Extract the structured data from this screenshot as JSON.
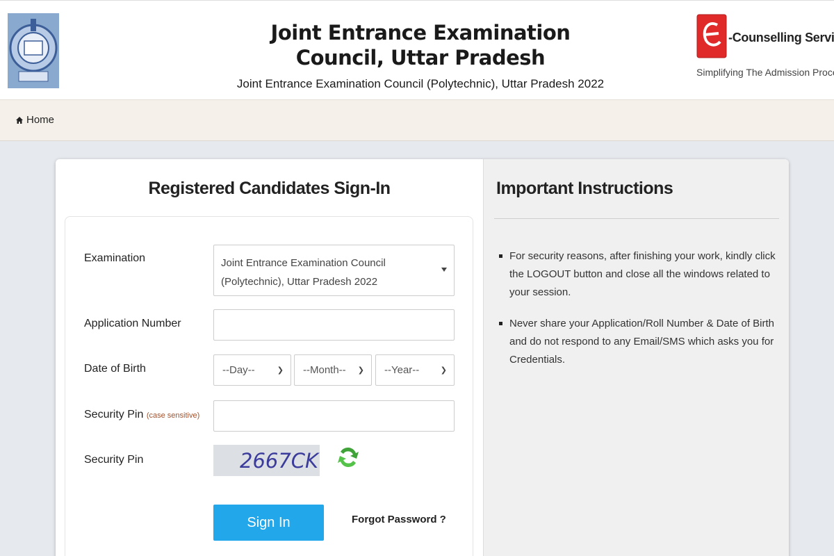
{
  "header": {
    "title": "Joint Entrance Examination Council, Uttar Pradesh",
    "subtitle": "Joint Entrance Examination Council (Polytechnic), Uttar Pradesh 2022",
    "logo_icon": "jeec-emblem-icon",
    "ec_brand": "-Counselling Services",
    "ec_tagline": "Simplifying The Admission Process",
    "ec_icon": "e-counselling-logo-icon"
  },
  "nav": {
    "home_label": "Home",
    "home_icon": "home-icon"
  },
  "signin": {
    "title": "Registered Candidates Sign-In",
    "fields": {
      "examination_label": "Examination",
      "examination_value": "Joint Entrance Examination Council (Polytechnic), Uttar Pradesh 2022",
      "application_label": "Application Number",
      "application_value": "",
      "dob_label": "Date of Birth",
      "dob_day": "--Day--",
      "dob_month": "--Month--",
      "dob_year": "--Year--",
      "pin_label": "Security Pin",
      "pin_note": "(case sensitive)",
      "pin_value": "",
      "captcha_label": "Security Pin",
      "captcha_text": "2667CK"
    },
    "signin_button": "Sign In",
    "forgot_link": "Forgot Password ?",
    "refresh_icon": "refresh-icon"
  },
  "instructions": {
    "title": "Important Instructions",
    "items": [
      "For security reasons, after finishing your work, kindly click the LOGOUT button and close all the windows related to your session.",
      "Never share your Application/Roll Number & Date of Birth and do not respond to any Email/SMS which asks you for Credentials."
    ]
  },
  "colors": {
    "primary_button": "#21a7ea",
    "navbar_bg": "#f5f1ea",
    "page_bg": "#e6e9ed",
    "instructions_bg": "#f0f0f0",
    "note_color": "#a0522d"
  }
}
